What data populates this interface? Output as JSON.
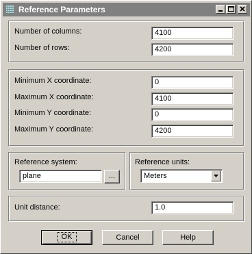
{
  "window": {
    "title": "Reference Parameters",
    "title_icon": "grid-app-icon",
    "controls": [
      "minimize-icon",
      "maximize-icon",
      "close-icon"
    ]
  },
  "dimensions": {
    "columns_label": "Number of columns:",
    "columns_value": "4100",
    "rows_label": "Number of rows:",
    "rows_value": "4200"
  },
  "coordinates": {
    "min_x_label": "Minimum X coordinate:",
    "min_x_value": "0",
    "max_x_label": "Maximum X coordinate:",
    "max_x_value": "4100",
    "min_y_label": "Minimum Y coordinate:",
    "min_y_value": "0",
    "max_y_label": "Maximum Y coordinate:",
    "max_y_value": "4200"
  },
  "reference": {
    "system_label": "Reference system:",
    "system_value": "plane",
    "browse_label": "...",
    "units_label": "Reference units:",
    "units_value": "Meters"
  },
  "unit_distance": {
    "label": "Unit distance:",
    "value": "1.0"
  },
  "buttons": {
    "ok": "OK",
    "cancel": "Cancel",
    "help": "Help"
  },
  "colors": {
    "face": "#d4d0c8",
    "titlebar_inactive": "#808080",
    "field_bg": "#ffffff"
  }
}
